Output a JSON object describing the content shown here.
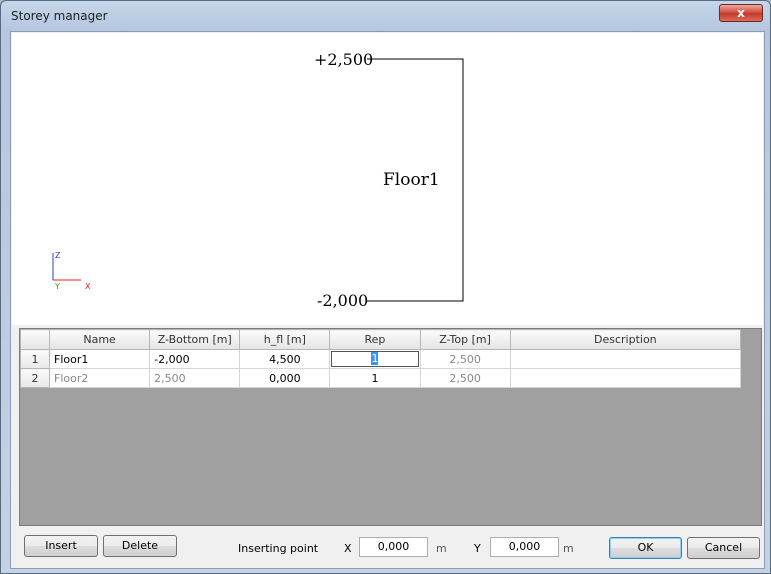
{
  "window": {
    "title": "Storey manager",
    "close_glyph": "x"
  },
  "preview": {
    "top_level": "+2,500",
    "bottom_level": "-2,000",
    "floor_label": "Floor1",
    "axis": {
      "z": "Z",
      "y": "Y",
      "x": "X"
    }
  },
  "table": {
    "columns": [
      "Name",
      "Z-Bottom [m]",
      "h_fl [m]",
      "Rep",
      "Z-Top [m]",
      "Description"
    ],
    "rows": [
      {
        "num": "1",
        "name": "Floor1",
        "z_bottom": "-2,000",
        "h_fl": "4,500",
        "rep": "1",
        "z_top": "2,500",
        "description": ""
      },
      {
        "num": "2",
        "name": "Floor2",
        "z_bottom": "2,500",
        "h_fl": "0,000",
        "rep": "1",
        "z_top": "2,500",
        "description": ""
      }
    ]
  },
  "footer": {
    "insert_label": "Insert",
    "delete_label": "Delete",
    "inserting_point_label": "Inserting point",
    "x_label": "X",
    "x_value": "0,000",
    "x_unit": "m",
    "y_label": "Y",
    "y_value": "0,000",
    "y_unit": "m",
    "ok_label": "OK",
    "cancel_label": "Cancel"
  },
  "colors": {
    "axis_z": "#3040c0",
    "axis_y": "#20b020",
    "axis_x": "#e02020",
    "selection": "#3399ff"
  }
}
